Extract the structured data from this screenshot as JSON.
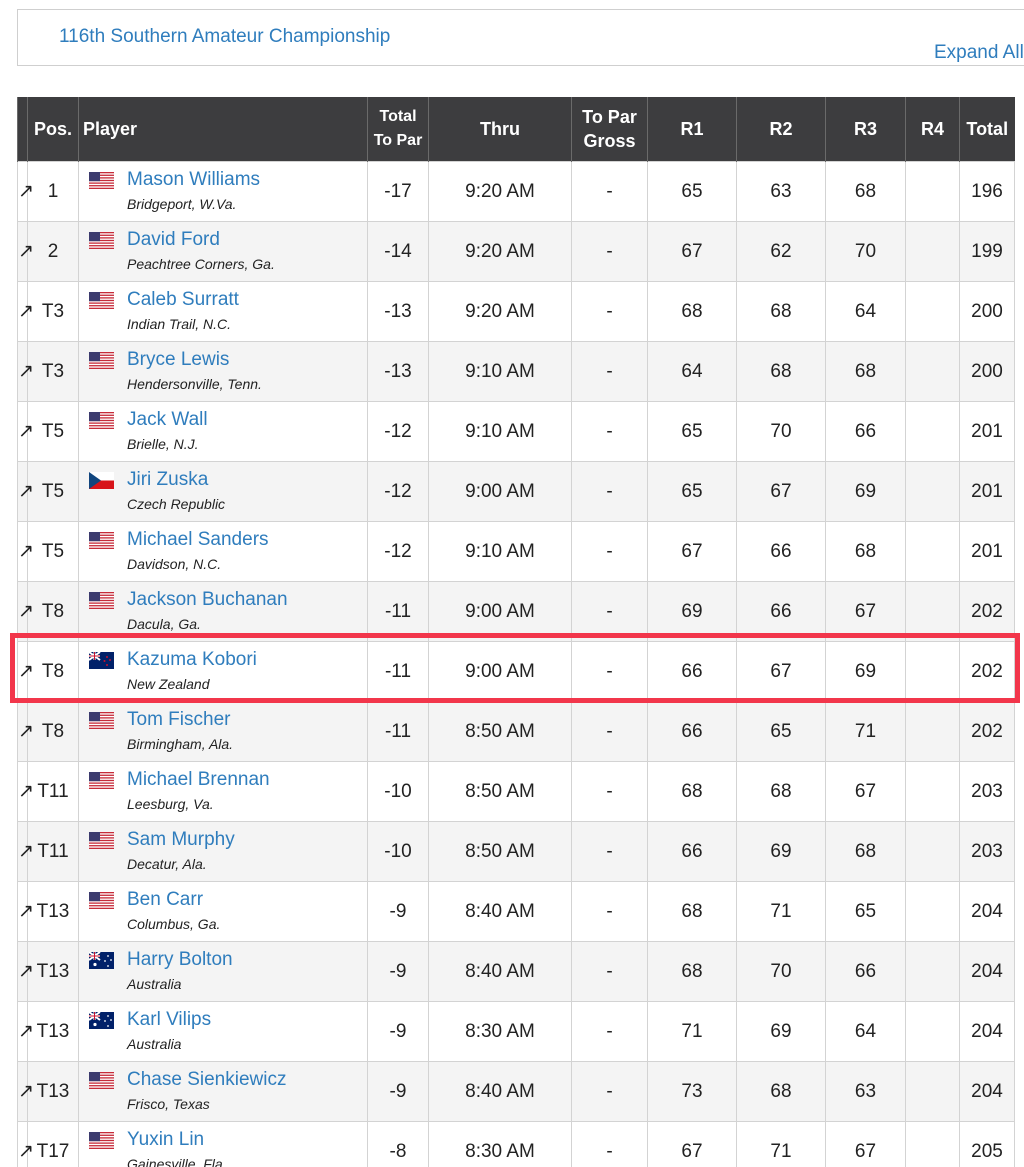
{
  "event": {
    "title": "116th Southern Amateur Championship",
    "expand_label": "Expand All"
  },
  "colors": {
    "link": "#2f7dbd",
    "header_bg": "#3d3d3f",
    "under_par": "#e01b1b",
    "over_par": "#2aa12a",
    "highlight": "#f2364b"
  },
  "columns": {
    "pos": "Pos.",
    "player": "Player",
    "total_to_par": [
      "Total",
      "To Par"
    ],
    "thru": "Thru",
    "to_par_gross": [
      "To Par",
      "Gross"
    ],
    "r1": "R1",
    "r2": "R2",
    "r3": "R3",
    "r4": "R4",
    "total": "Total"
  },
  "rows": [
    {
      "pos": "1",
      "name": "Mason Williams",
      "loc": "Bridgeport, W.Va.",
      "flag": "usa-flag-icon",
      "to_par": "-17",
      "thru": "9:20 AM",
      "gross": "-",
      "r1": "65",
      "r2": "63",
      "r3": "68",
      "r4": "",
      "total": "196"
    },
    {
      "pos": "2",
      "name": "David Ford",
      "loc": "Peachtree Corners, Ga.",
      "flag": "usa-flag-icon",
      "to_par": "-14",
      "thru": "9:20 AM",
      "gross": "-",
      "r1": "67",
      "r2": "62",
      "r3": "70",
      "r4": "",
      "total": "199"
    },
    {
      "pos": "T3",
      "name": "Caleb Surratt",
      "loc": "Indian Trail, N.C.",
      "flag": "usa-flag-icon",
      "to_par": "-13",
      "thru": "9:20 AM",
      "gross": "-",
      "r1": "68",
      "r2": "68",
      "r3": "64",
      "r4": "",
      "total": "200"
    },
    {
      "pos": "T3",
      "name": "Bryce Lewis",
      "loc": "Hendersonville, Tenn.",
      "flag": "usa-flag-icon",
      "to_par": "-13",
      "thru": "9:10 AM",
      "gross": "-",
      "r1": "64",
      "r2": "68",
      "r3": "68",
      "r4": "",
      "total": "200"
    },
    {
      "pos": "T5",
      "name": "Jack Wall",
      "loc": "Brielle, N.J.",
      "flag": "usa-flag-icon",
      "to_par": "-12",
      "thru": "9:10 AM",
      "gross": "-",
      "r1": "65",
      "r2": "70",
      "r3": "66",
      "r4": "",
      "total": "201"
    },
    {
      "pos": "T5",
      "name": "Jiri Zuska",
      "loc": "Czech Republic",
      "flag": "czech-flag-icon",
      "to_par": "-12",
      "thru": "9:00 AM",
      "gross": "-",
      "r1": "65",
      "r2": "67",
      "r3": "69",
      "r4": "",
      "total": "201"
    },
    {
      "pos": "T5",
      "name": "Michael Sanders",
      "loc": "Davidson, N.C.",
      "flag": "usa-flag-icon",
      "to_par": "-12",
      "thru": "9:10 AM",
      "gross": "-",
      "r1": "67",
      "r2": "66",
      "r3": "68",
      "r4": "",
      "total": "201"
    },
    {
      "pos": "T8",
      "name": "Jackson Buchanan",
      "loc": "Dacula, Ga.",
      "flag": "usa-flag-icon",
      "to_par": "-11",
      "thru": "9:00 AM",
      "gross": "-",
      "r1": "69",
      "r2": "66",
      "r3": "67",
      "r4": "",
      "total": "202"
    },
    {
      "pos": "T8",
      "name": "Kazuma Kobori",
      "loc": "New Zealand",
      "flag": "new-zealand-flag-icon",
      "to_par": "-11",
      "thru": "9:00 AM",
      "gross": "-",
      "r1": "66",
      "r2": "67",
      "r3": "69",
      "r4": "",
      "total": "202",
      "highlighted": true
    },
    {
      "pos": "T8",
      "name": "Tom Fischer",
      "loc": "Birmingham, Ala.",
      "flag": "usa-flag-icon",
      "to_par": "-11",
      "thru": "8:50 AM",
      "gross": "-",
      "r1": "66",
      "r2": "65",
      "r3": "71",
      "r4": "",
      "total": "202"
    },
    {
      "pos": "T11",
      "name": "Michael Brennan",
      "loc": "Leesburg, Va.",
      "flag": "usa-flag-icon",
      "to_par": "-10",
      "thru": "8:50 AM",
      "gross": "-",
      "r1": "68",
      "r2": "68",
      "r3": "67",
      "r4": "",
      "total": "203"
    },
    {
      "pos": "T11",
      "name": "Sam Murphy",
      "loc": "Decatur, Ala.",
      "flag": "usa-flag-icon",
      "to_par": "-10",
      "thru": "8:50 AM",
      "gross": "-",
      "r1": "66",
      "r2": "69",
      "r3": "68",
      "r4": "",
      "total": "203"
    },
    {
      "pos": "T13",
      "name": "Ben Carr",
      "loc": "Columbus, Ga.",
      "flag": "usa-flag-icon",
      "to_par": "-9",
      "thru": "8:40 AM",
      "gross": "-",
      "r1": "68",
      "r2": "71",
      "r3": "65",
      "r4": "",
      "total": "204"
    },
    {
      "pos": "T13",
      "name": "Harry Bolton",
      "loc": "Australia",
      "flag": "australia-flag-icon",
      "to_par": "-9",
      "thru": "8:40 AM",
      "gross": "-",
      "r1": "68",
      "r2": "70",
      "r3": "66",
      "r4": "",
      "total": "204"
    },
    {
      "pos": "T13",
      "name": "Karl Vilips",
      "loc": "Australia",
      "flag": "australia-flag-icon",
      "to_par": "-9",
      "thru": "8:30 AM",
      "gross": "-",
      "r1": "71",
      "r2": "69",
      "r3": "64",
      "r4": "",
      "total": "204"
    },
    {
      "pos": "T13",
      "name": "Chase Sienkiewicz",
      "loc": "Frisco, Texas",
      "flag": "usa-flag-icon",
      "to_par": "-9",
      "thru": "8:40 AM",
      "gross": "-",
      "r1": "73",
      "r2": "68",
      "r3": "63",
      "r4": "",
      "total": "204"
    },
    {
      "pos": "T17",
      "name": "Yuxin Lin",
      "loc": "Gainesville, Fla.",
      "flag": "usa-flag-icon",
      "to_par": "-8",
      "thru": "8:30 AM",
      "gross": "-",
      "r1": "67",
      "r2": "71",
      "r3": "67",
      "r4": "",
      "total": "205"
    }
  ]
}
